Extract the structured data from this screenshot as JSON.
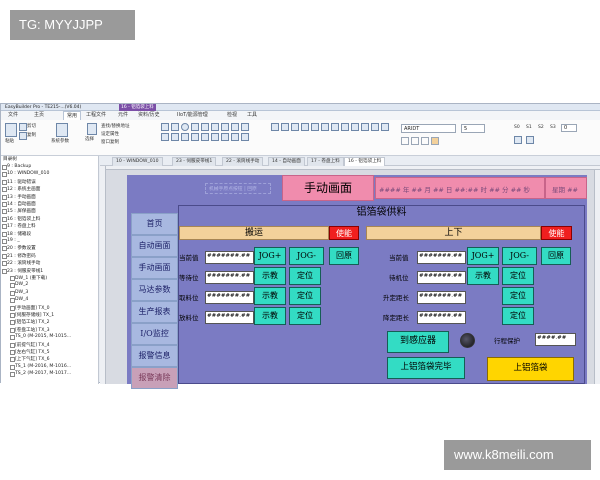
{
  "watermarks": {
    "top": "TG: MYYJJPP",
    "bottom": "www.k8meili.com"
  },
  "app": {
    "title": "EasyBuilder Pro - TE215-...(V6.04)",
    "active_doc": "16 - 铝箔袋上料"
  },
  "ribbon_tabs": [
    "文件",
    "主页",
    "常用",
    "工程文件",
    "元件",
    "资料/历史",
    "IIoT/能源管理",
    "检视",
    "工具"
  ],
  "ribbon": {
    "paste": "粘贴",
    "cut": "剪切",
    "copy": "复制",
    "system_params": "系统参数",
    "select": "选择",
    "replace": "替换",
    "find_replace": "查找/替换地址",
    "attr": "设定属性",
    "window_copy": "窗口复制",
    "font": "ARIDT",
    "size": "5",
    "s_states": [
      "S0",
      "S1",
      "S2",
      "S3"
    ],
    "state_val": "0"
  },
  "sidebar": {
    "header": "目录树",
    "items": [
      "9 : Backup",
      "10 : WINDOW_010",
      "11 : 驱动错误",
      "12 : 系统主画面",
      "13 : 手动画面",
      "14 : 自动画面",
      "15 : 屏保画面",
      "16 : 铝箔袋上料",
      "17 : 卷盘上料",
      "18 : 储箱段",
      "19 : _",
      "20 : 参数设置",
      "21 : 修改密码",
      "22 : 滚筒线手动",
      "23 : 伺服皮带线1",
      "DW_1 (重下载)",
      "DW_2",
      "DW_3",
      "DW_4",
      "[手动画面] TX_0",
      "[伺服存储线] TX_1",
      "[铝箔工站] TX_2",
      "[卷盘工站] TX_3",
      "TS_0 (M-2015, M-1015...",
      "[前提气缸] TX_4",
      "[左右气缸] TX_5",
      "[上下气缸] TX_6",
      "TS_1 (M-2016, M-1016...",
      "TS_2 (M-2017, M-1017..."
    ]
  },
  "doc_tabs": [
    "10 - WINDOW_010",
    "23 - 伺服皮带线1",
    "22 - 滚筒线手动",
    "14 - 自动画面",
    "17 - 卷盘上料",
    "16 - 铝箔袋上料"
  ],
  "hmi": {
    "title": "手动画面",
    "datetime": "#### 年 ## 月 ## 日 ##:## 时 ## 分 ## 秒",
    "weekday": "星期 ##",
    "faint_button": "机械手原点按钮 | 回原",
    "nav": [
      "首页",
      "自动画面",
      "手动画面",
      "马达参数",
      "生产报表",
      "I/O监控",
      "报警信息",
      "报警清除"
    ],
    "section_title": "铝箔袋供料",
    "left": {
      "header": "搬运",
      "enable": "使能",
      "rows": [
        {
          "label": "当前值",
          "value": "#######.##",
          "b1": "JOG+",
          "b2": "JOG-",
          "b3": "回原"
        },
        {
          "label": "等待位",
          "value": "#######.##",
          "b1": "示教",
          "b2": "定位"
        },
        {
          "label": "取料位",
          "value": "#######.##",
          "b1": "示教",
          "b2": "定位"
        },
        {
          "label": "放料位",
          "value": "#######.##",
          "b1": "示教",
          "b2": "定位"
        }
      ]
    },
    "right": {
      "header": "上下",
      "enable": "使能",
      "rows": [
        {
          "label": "当前值",
          "value": "#######.##",
          "b1": "JOG+",
          "b2": "JOG-",
          "b3": "回原"
        },
        {
          "label": "待机位",
          "value": "#######.##",
          "b1": "示教",
          "b2": "定位"
        },
        {
          "label": "升定距长",
          "value": "#######.##",
          "b2": "定位"
        },
        {
          "label": "降定距长",
          "value": "#######.##",
          "b2": "定位"
        }
      ],
      "sensor": "到感应器",
      "stroke_label": "行程保护",
      "stroke_value": "####.##",
      "done_btn": "上铝箔袋完毕",
      "load_btn": "上铝箔袋"
    }
  }
}
